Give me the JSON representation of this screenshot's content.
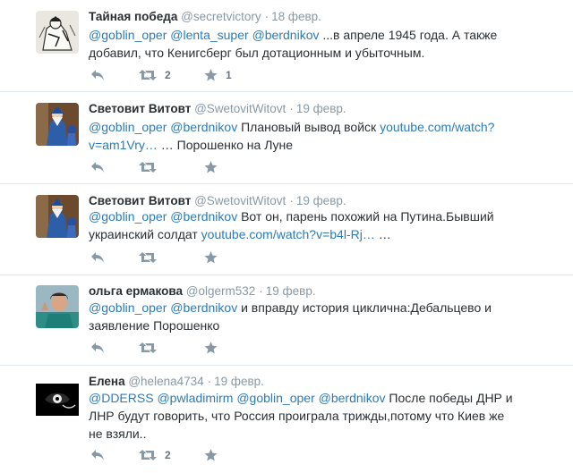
{
  "tweets": [
    {
      "fullname": "Тайная победа",
      "username": "@secretvictory",
      "time": "18 февр.",
      "parts": [
        {
          "t": "@goblin_oper",
          "m": true
        },
        {
          "t": " ",
          "m": false
        },
        {
          "t": "@lenta_super",
          "m": true
        },
        {
          "t": " ",
          "m": false
        },
        {
          "t": "@berdnikov",
          "m": true
        },
        {
          "t": " ...в апреле 1945 года. А также добавил, что Кенигсберг был дотационным и убыточным.",
          "m": false
        }
      ],
      "retweet_count": "2",
      "favorite_count": "1"
    },
    {
      "fullname": "Световит Витовт",
      "username": "@SwetovitWitovt",
      "time": "19 февр.",
      "parts": [
        {
          "t": "@goblin_oper",
          "m": true
        },
        {
          "t": " ",
          "m": false
        },
        {
          "t": "@berdnikov",
          "m": true
        },
        {
          "t": " Плановый вывод войск ",
          "m": false
        },
        {
          "t": "youtube.com/watch?v=am1Vry…",
          "m": true
        },
        {
          "t": " … Порошенко на Луне",
          "m": false
        }
      ],
      "retweet_count": "",
      "favorite_count": ""
    },
    {
      "fullname": "Световит Витовт",
      "username": "@SwetovitWitovt",
      "time": "19 февр.",
      "parts": [
        {
          "t": "@goblin_oper",
          "m": true
        },
        {
          "t": " ",
          "m": false
        },
        {
          "t": "@berdnikov",
          "m": true
        },
        {
          "t": " Вот он, парень похожий на Путина.Бывший украинский солдат ",
          "m": false
        },
        {
          "t": "youtube.com/watch?v=b4l-Rj…",
          "m": true
        },
        {
          "t": " …",
          "m": false
        }
      ],
      "retweet_count": "",
      "favorite_count": ""
    },
    {
      "fullname": "ольга ермакова",
      "username": "@olgerm532",
      "time": "19 февр.",
      "parts": [
        {
          "t": "@goblin_oper",
          "m": true
        },
        {
          "t": " ",
          "m": false
        },
        {
          "t": "@berdnikov",
          "m": true
        },
        {
          "t": " и вправду  история циклична:Дебальцево и заявление  Порошенко",
          "m": false
        }
      ],
      "retweet_count": "",
      "favorite_count": ""
    },
    {
      "fullname": "Елена",
      "username": "@helena4734",
      "time": "19 февр.",
      "parts": [
        {
          "t": "@DDERSS",
          "m": true
        },
        {
          "t": " ",
          "m": false
        },
        {
          "t": "@pwladimirm",
          "m": true
        },
        {
          "t": " ",
          "m": false
        },
        {
          "t": "@goblin_oper",
          "m": true
        },
        {
          "t": " ",
          "m": false
        },
        {
          "t": "@berdnikov",
          "m": true
        },
        {
          "t": " После победы ДНР и ЛНР будут говорить, что Россия проиграла трижды,потому что Киев же не взяли..",
          "m": false
        }
      ],
      "retweet_count": "2",
      "favorite_count": ""
    }
  ],
  "colors": {
    "link": "#2b7bb9",
    "muted": "#8899a6",
    "icon": "#8899a6",
    "divider": "#e1e8ed"
  },
  "icons": [
    "reply-icon",
    "retweet-icon",
    "favorite-icon"
  ]
}
